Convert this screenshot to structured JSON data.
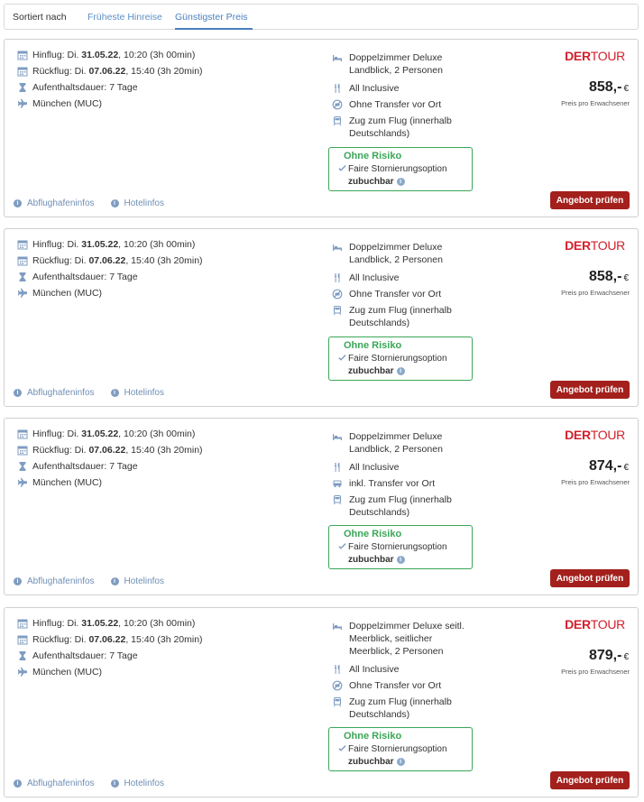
{
  "sortbar": {
    "label": "Sortiert nach",
    "options": [
      "Früheste Hinreise",
      "Günstigster Preis"
    ],
    "active": "Günstigster Preis"
  },
  "colors": {
    "accent": "#4a7fc0",
    "risk_green": "#3aa757",
    "cta": "#a3201c",
    "logo": "#d4202c"
  },
  "offers": [
    {
      "outbound_label": "Hinflug: Di.",
      "outbound_date": "31.05.22",
      "outbound_rest": ", 10:20 (3h 00min)",
      "return_label": "Rückflug: Di.",
      "return_date": "07.06.22",
      "return_rest": ", 15:40 (3h 20min)",
      "stay": "Aufenthaltsdauer: 7 Tage",
      "airport": "München (MUC)",
      "room": "Doppelzimmer Deluxe Landblick, 2 Personen",
      "board": "All Inclusive",
      "transfer": "Ohne Transfer vor Ort",
      "transfer_icon": "no-transfer-icon",
      "train": "Zug zum Flug (innerhalb Deutschlands)",
      "risk_title": "Ohne Risiko",
      "risk_line1": "Faire Stornierungsoption",
      "risk_line2": "zubuchbar",
      "logo_der": "DER",
      "logo_tour": "TOUR",
      "price": "858,-",
      "currency": "€",
      "price_note": "Preis pro Erwachsener",
      "link_airport": "Abflughafeninfos",
      "link_hotel": "Hotelinfos",
      "cta": "Angebot prüfen"
    },
    {
      "outbound_label": "Hinflug: Di.",
      "outbound_date": "31.05.22",
      "outbound_rest": ", 10:20 (3h 00min)",
      "return_label": "Rückflug: Di.",
      "return_date": "07.06.22",
      "return_rest": ", 15:40 (3h 20min)",
      "stay": "Aufenthaltsdauer: 7 Tage",
      "airport": "München (MUC)",
      "room": "Doppelzimmer Deluxe Landblick, 2 Personen",
      "board": "All Inclusive",
      "transfer": "Ohne Transfer vor Ort",
      "transfer_icon": "no-transfer-icon",
      "train": "Zug zum Flug (innerhalb Deutschlands)",
      "risk_title": "Ohne Risiko",
      "risk_line1": "Faire Stornierungsoption",
      "risk_line2": "zubuchbar",
      "logo_der": "DER",
      "logo_tour": "TOUR",
      "price": "858,-",
      "currency": "€",
      "price_note": "Preis pro Erwachsener",
      "link_airport": "Abflughafeninfos",
      "link_hotel": "Hotelinfos",
      "cta": "Angebot prüfen"
    },
    {
      "outbound_label": "Hinflug: Di.",
      "outbound_date": "31.05.22",
      "outbound_rest": ", 10:20 (3h 00min)",
      "return_label": "Rückflug: Di.",
      "return_date": "07.06.22",
      "return_rest": ", 15:40 (3h 20min)",
      "stay": "Aufenthaltsdauer: 7 Tage",
      "airport": "München (MUC)",
      "room": "Doppelzimmer Deluxe Landblick, 2 Personen",
      "board": "All Inclusive",
      "transfer": "inkl. Transfer vor Ort",
      "transfer_icon": "bus-icon",
      "train": "Zug zum Flug (innerhalb Deutschlands)",
      "risk_title": "Ohne Risiko",
      "risk_line1": "Faire Stornierungsoption",
      "risk_line2": "zubuchbar",
      "logo_der": "DER",
      "logo_tour": "TOUR",
      "price": "874,-",
      "currency": "€",
      "price_note": "Preis pro Erwachsener",
      "link_airport": "Abflughafeninfos",
      "link_hotel": "Hotelinfos",
      "cta": "Angebot prüfen"
    },
    {
      "outbound_label": "Hinflug: Di.",
      "outbound_date": "31.05.22",
      "outbound_rest": ", 10:20 (3h 00min)",
      "return_label": "Rückflug: Di.",
      "return_date": "07.06.22",
      "return_rest": ", 15:40 (3h 20min)",
      "stay": "Aufenthaltsdauer: 7 Tage",
      "airport": "München (MUC)",
      "room": "Doppelzimmer Deluxe seitl. Meerblick, seitlicher Meerblick, 2 Personen",
      "board": "All Inclusive",
      "transfer": "Ohne Transfer vor Ort",
      "transfer_icon": "no-transfer-icon",
      "train": "Zug zum Flug (innerhalb Deutschlands)",
      "risk_title": "Ohne Risiko",
      "risk_line1": "Faire Stornierungsoption",
      "risk_line2": "zubuchbar",
      "logo_der": "DER",
      "logo_tour": "TOUR",
      "price": "879,-",
      "currency": "€",
      "price_note": "Preis pro Erwachsener",
      "link_airport": "Abflughafeninfos",
      "link_hotel": "Hotelinfos",
      "cta": "Angebot prüfen"
    }
  ]
}
